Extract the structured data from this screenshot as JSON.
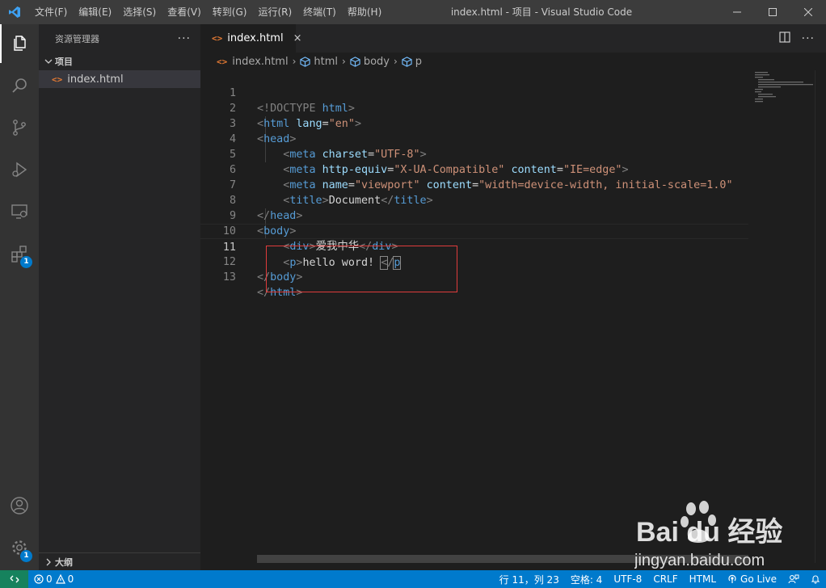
{
  "titlebar": {
    "menu": [
      "文件(F)",
      "编辑(E)",
      "选择(S)",
      "查看(V)",
      "转到(G)",
      "运行(R)",
      "终端(T)",
      "帮助(H)"
    ],
    "window_title": "index.html - 项目 - Visual Studio Code"
  },
  "activitybar": {
    "items": [
      "files-icon",
      "search-icon",
      "source-control-icon",
      "run-debug-icon",
      "remote-explorer-icon",
      "extensions-icon"
    ],
    "extensions_badge": "1",
    "settings_badge": "1"
  },
  "sidebar": {
    "title": "资源管理器",
    "more": "···",
    "folder": "项目",
    "file": "index.html",
    "outline": "大纲"
  },
  "editor": {
    "tab_label": "index.html",
    "tab_close": "×",
    "more": "···",
    "breadcrumb": [
      "index.html",
      "html",
      "body",
      "p"
    ],
    "line_numbers": [
      "1",
      "2",
      "3",
      "4",
      "5",
      "6",
      "7",
      "8",
      "9",
      "10",
      "11",
      "12",
      "13"
    ],
    "current_line": "11"
  },
  "statusbar": {
    "errors": "0",
    "warnings": "0",
    "position": "行 11，列 23",
    "spaces": "空格: 4",
    "encoding": "UTF-8",
    "eol": "CRLF",
    "language": "HTML",
    "go_live": "Go Live"
  },
  "watermark": {
    "brand": "Bai du 经验",
    "url": "jingyan.baidu.com"
  },
  "colors": {
    "accent": "#007acc",
    "highlight_box": "#e03c3c",
    "remote": "#16825d"
  }
}
